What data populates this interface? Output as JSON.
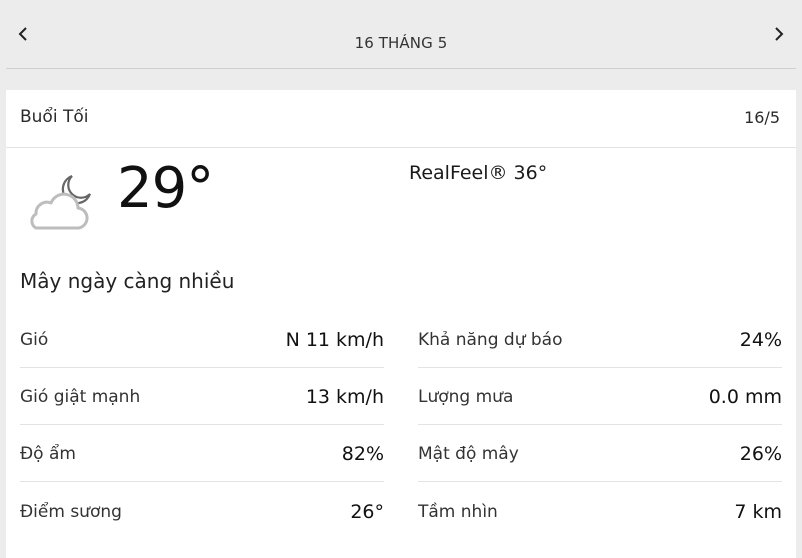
{
  "header": {
    "date_title": "16 THÁNG 5",
    "prev_icon": "chevron-left-icon",
    "next_icon": "chevron-right-icon"
  },
  "card": {
    "period": "Buổi Tối",
    "short_date": "16/5",
    "icon": "cloud-moon-icon",
    "temperature": "29°",
    "realfeel": "RealFeel® 36°",
    "phrase": "Mây ngày càng nhiều"
  },
  "details": {
    "left": [
      {
        "label": "Gió",
        "value": "N 11 km/h"
      },
      {
        "label": "Gió giật mạnh",
        "value": "13 km/h"
      },
      {
        "label": "Độ ẩm",
        "value": "82%"
      },
      {
        "label": "Điểm sương",
        "value": "26°"
      }
    ],
    "right": [
      {
        "label": "Khả năng dự báo",
        "value": "24%"
      },
      {
        "label": "Lượng mưa",
        "value": "0.0 mm"
      },
      {
        "label": "Mật độ mây",
        "value": "26%"
      },
      {
        "label": "Tầm nhìn",
        "value": "7 km"
      }
    ]
  }
}
